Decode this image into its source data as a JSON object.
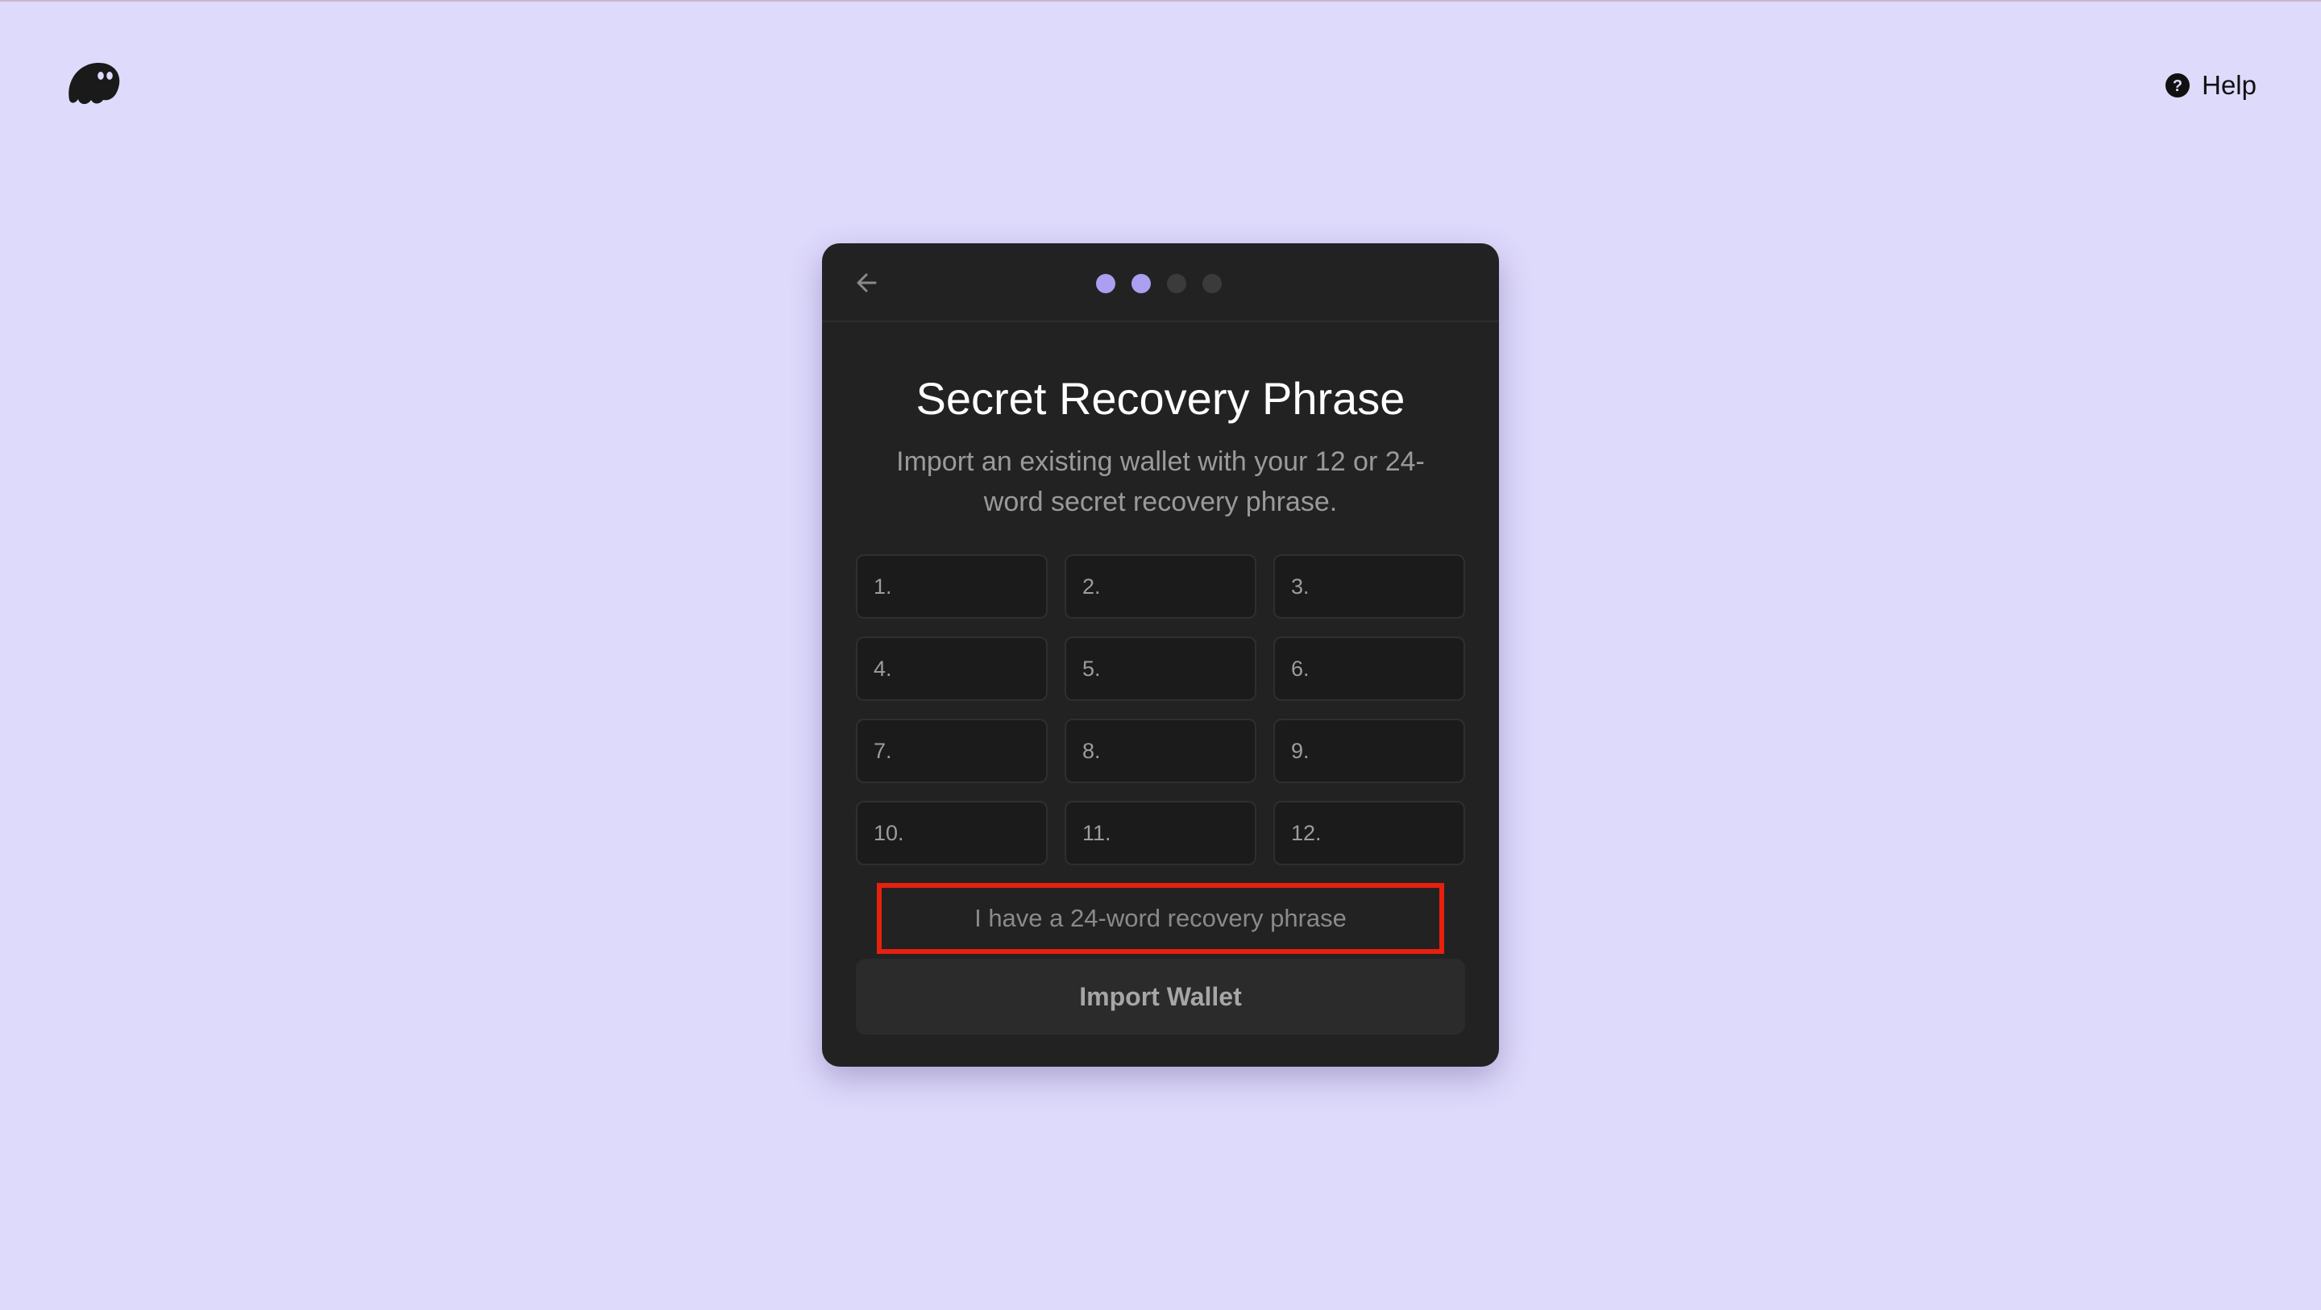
{
  "topbar": {
    "logo_icon": "phantom-ghost-icon",
    "help_icon": "question-circle-icon",
    "help_label": "Help"
  },
  "card": {
    "back_icon": "arrow-left-icon",
    "steps": {
      "total": 4,
      "completed": 2
    },
    "title": "Secret Recovery Phrase",
    "subtitle": "Import an existing wallet with your 12 or 24-word secret recovery phrase.",
    "word_fields": [
      "1.",
      "2.",
      "3.",
      "4.",
      "5.",
      "6.",
      "7.",
      "8.",
      "9.",
      "10.",
      "11.",
      "12."
    ],
    "toggle_24_label": "I have a 24-word recovery phrase",
    "import_button_label": "Import Wallet"
  },
  "colors": {
    "background": "#dedafc",
    "card": "#222222",
    "accent": "#ab9ff2",
    "highlight_box": "#e8200e"
  }
}
